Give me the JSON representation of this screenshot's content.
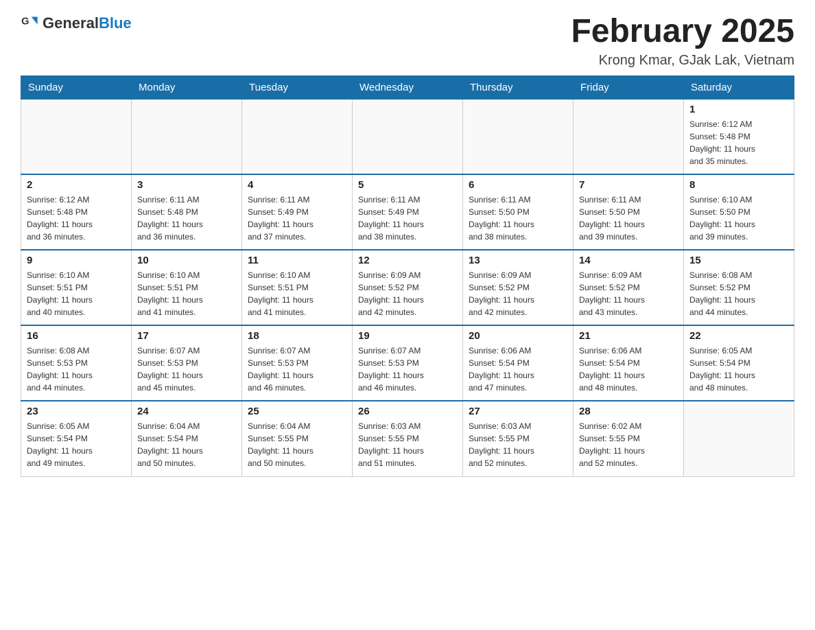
{
  "header": {
    "logo_general": "General",
    "logo_blue": "Blue",
    "month_title": "February 2025",
    "location": "Krong Kmar, GJak Lak, Vietnam"
  },
  "days_of_week": [
    "Sunday",
    "Monday",
    "Tuesday",
    "Wednesday",
    "Thursday",
    "Friday",
    "Saturday"
  ],
  "weeks": [
    [
      {
        "day": "",
        "info": ""
      },
      {
        "day": "",
        "info": ""
      },
      {
        "day": "",
        "info": ""
      },
      {
        "day": "",
        "info": ""
      },
      {
        "day": "",
        "info": ""
      },
      {
        "day": "",
        "info": ""
      },
      {
        "day": "1",
        "info": "Sunrise: 6:12 AM\nSunset: 5:48 PM\nDaylight: 11 hours\nand 35 minutes."
      }
    ],
    [
      {
        "day": "2",
        "info": "Sunrise: 6:12 AM\nSunset: 5:48 PM\nDaylight: 11 hours\nand 36 minutes."
      },
      {
        "day": "3",
        "info": "Sunrise: 6:11 AM\nSunset: 5:48 PM\nDaylight: 11 hours\nand 36 minutes."
      },
      {
        "day": "4",
        "info": "Sunrise: 6:11 AM\nSunset: 5:49 PM\nDaylight: 11 hours\nand 37 minutes."
      },
      {
        "day": "5",
        "info": "Sunrise: 6:11 AM\nSunset: 5:49 PM\nDaylight: 11 hours\nand 38 minutes."
      },
      {
        "day": "6",
        "info": "Sunrise: 6:11 AM\nSunset: 5:50 PM\nDaylight: 11 hours\nand 38 minutes."
      },
      {
        "day": "7",
        "info": "Sunrise: 6:11 AM\nSunset: 5:50 PM\nDaylight: 11 hours\nand 39 minutes."
      },
      {
        "day": "8",
        "info": "Sunrise: 6:10 AM\nSunset: 5:50 PM\nDaylight: 11 hours\nand 39 minutes."
      }
    ],
    [
      {
        "day": "9",
        "info": "Sunrise: 6:10 AM\nSunset: 5:51 PM\nDaylight: 11 hours\nand 40 minutes."
      },
      {
        "day": "10",
        "info": "Sunrise: 6:10 AM\nSunset: 5:51 PM\nDaylight: 11 hours\nand 41 minutes."
      },
      {
        "day": "11",
        "info": "Sunrise: 6:10 AM\nSunset: 5:51 PM\nDaylight: 11 hours\nand 41 minutes."
      },
      {
        "day": "12",
        "info": "Sunrise: 6:09 AM\nSunset: 5:52 PM\nDaylight: 11 hours\nand 42 minutes."
      },
      {
        "day": "13",
        "info": "Sunrise: 6:09 AM\nSunset: 5:52 PM\nDaylight: 11 hours\nand 42 minutes."
      },
      {
        "day": "14",
        "info": "Sunrise: 6:09 AM\nSunset: 5:52 PM\nDaylight: 11 hours\nand 43 minutes."
      },
      {
        "day": "15",
        "info": "Sunrise: 6:08 AM\nSunset: 5:52 PM\nDaylight: 11 hours\nand 44 minutes."
      }
    ],
    [
      {
        "day": "16",
        "info": "Sunrise: 6:08 AM\nSunset: 5:53 PM\nDaylight: 11 hours\nand 44 minutes."
      },
      {
        "day": "17",
        "info": "Sunrise: 6:07 AM\nSunset: 5:53 PM\nDaylight: 11 hours\nand 45 minutes."
      },
      {
        "day": "18",
        "info": "Sunrise: 6:07 AM\nSunset: 5:53 PM\nDaylight: 11 hours\nand 46 minutes."
      },
      {
        "day": "19",
        "info": "Sunrise: 6:07 AM\nSunset: 5:53 PM\nDaylight: 11 hours\nand 46 minutes."
      },
      {
        "day": "20",
        "info": "Sunrise: 6:06 AM\nSunset: 5:54 PM\nDaylight: 11 hours\nand 47 minutes."
      },
      {
        "day": "21",
        "info": "Sunrise: 6:06 AM\nSunset: 5:54 PM\nDaylight: 11 hours\nand 48 minutes."
      },
      {
        "day": "22",
        "info": "Sunrise: 6:05 AM\nSunset: 5:54 PM\nDaylight: 11 hours\nand 48 minutes."
      }
    ],
    [
      {
        "day": "23",
        "info": "Sunrise: 6:05 AM\nSunset: 5:54 PM\nDaylight: 11 hours\nand 49 minutes."
      },
      {
        "day": "24",
        "info": "Sunrise: 6:04 AM\nSunset: 5:54 PM\nDaylight: 11 hours\nand 50 minutes."
      },
      {
        "day": "25",
        "info": "Sunrise: 6:04 AM\nSunset: 5:55 PM\nDaylight: 11 hours\nand 50 minutes."
      },
      {
        "day": "26",
        "info": "Sunrise: 6:03 AM\nSunset: 5:55 PM\nDaylight: 11 hours\nand 51 minutes."
      },
      {
        "day": "27",
        "info": "Sunrise: 6:03 AM\nSunset: 5:55 PM\nDaylight: 11 hours\nand 52 minutes."
      },
      {
        "day": "28",
        "info": "Sunrise: 6:02 AM\nSunset: 5:55 PM\nDaylight: 11 hours\nand 52 minutes."
      },
      {
        "day": "",
        "info": ""
      }
    ]
  ]
}
